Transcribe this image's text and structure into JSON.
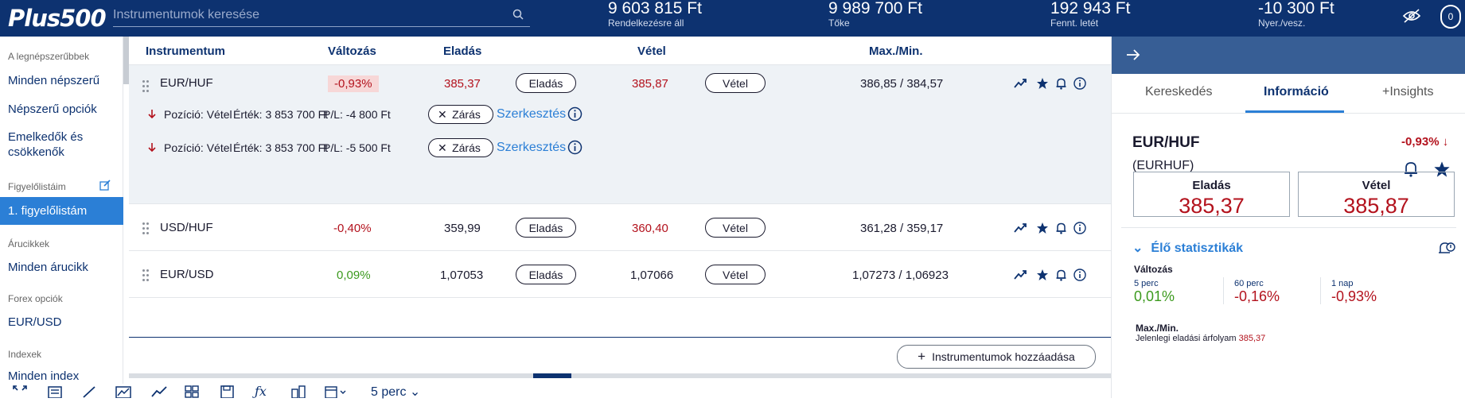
{
  "header": {
    "logo": "Plus500",
    "search_placeholder": "Instrumentumok keresése",
    "stats": [
      {
        "value": "9 603 815 Ft",
        "label": "Rendelkezésre áll"
      },
      {
        "value": "9 989 700 Ft",
        "label": "Tőke"
      },
      {
        "value": "192 943 Ft",
        "label": "Fennt. letét"
      },
      {
        "value": "-10 300 Ft",
        "label": "Nyer./vesz."
      }
    ],
    "profile_initial": "0"
  },
  "sidebar": {
    "sections": [
      {
        "heading": "A legnépszerűbbek",
        "items": [
          "Minden népszerű",
          "Népszerű opciók",
          "Emelkedők és csökkenők"
        ]
      },
      {
        "heading": "Figyelőlistáim",
        "items": [
          "1. figyelőlistám"
        ]
      },
      {
        "heading": "Árucikkek",
        "items": [
          "Minden árucikk"
        ]
      },
      {
        "heading": "Forex opciók",
        "items": [
          "EUR/USD"
        ]
      },
      {
        "heading": "Indexek",
        "items": [
          "Minden index"
        ]
      }
    ]
  },
  "table": {
    "headers": {
      "instrument": "Instrumentum",
      "change": "Változás",
      "sell": "Eladás",
      "buy": "Vétel",
      "maxmin": "Max./Min."
    },
    "sell_button": "Eladás",
    "buy_button": "Vétel",
    "rows": [
      {
        "name": "EUR/HUF",
        "change": "-0,93%",
        "sell": "385,37",
        "buy": "385,87",
        "maxmin": "386,85 / 384,57"
      },
      {
        "name": "USD/HUF",
        "change": "-0,40%",
        "sell": "359,99",
        "buy": "360,40",
        "maxmin": "361,28 / 359,17"
      },
      {
        "name": "EUR/USD",
        "change": "0,09%",
        "sell": "1,07053",
        "buy": "1,07066",
        "maxmin": "1,07273 / 1,06923"
      }
    ],
    "positions": [
      {
        "position": "Pozíció: Vétel",
        "value": "Érték: 3 853 700 Ft",
        "pl": "P/L: -4 800 Ft",
        "close": "Zárás",
        "edit": "Szerkesztés"
      },
      {
        "position": "Pozíció: Vétel",
        "value": "Érték: 3 853 700 Ft",
        "pl": "P/L: -5 500 Ft",
        "close": "Zárás",
        "edit": "Szerkesztés"
      }
    ],
    "add_button": "Instrumentumok hozzáadása"
  },
  "toolbar": {
    "timeframe": "5 perc"
  },
  "panel": {
    "tabs": [
      "Kereskedés",
      "Információ",
      "+Insights"
    ],
    "instrument": "EUR/HUF",
    "code": "(EURHUF)",
    "change": "-0,93%",
    "sell_label": "Eladás",
    "sell_price": "385,37",
    "buy_label": "Vétel",
    "buy_price": "385,87",
    "live_stats_title": "Élő statisztikák",
    "change_label": "Változás",
    "periods": [
      {
        "label": "5 perc",
        "value": "0,01%"
      },
      {
        "label": "60 perc",
        "value": "-0,16%"
      },
      {
        "label": "1 nap",
        "value": "-0,93%"
      }
    ],
    "maxmin_label": "Max./Min.",
    "current_sell_label": "Jelenlegi eladási árfolyam",
    "current_sell_value": "385,37"
  },
  "colors": {
    "brand": "#0d3270",
    "accent": "#2b7fd6",
    "negative": "#b3121d",
    "positive": "#3c9a1e"
  }
}
